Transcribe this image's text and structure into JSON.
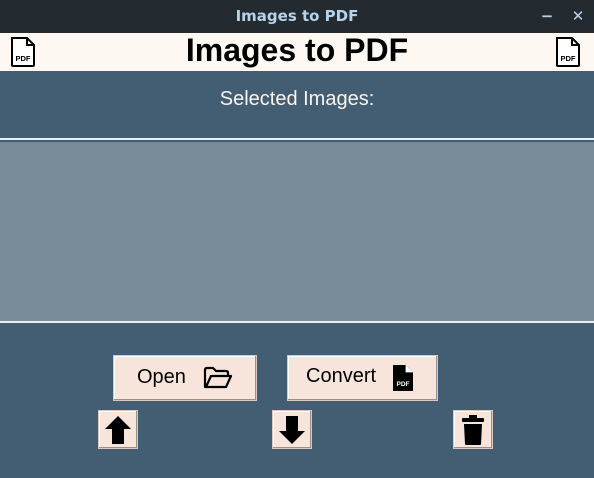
{
  "window": {
    "title": "Images to PDF",
    "minimize_glyph": "−",
    "close_glyph": "✕"
  },
  "header": {
    "title": "Images to PDF",
    "left_icon": "pdf-file-icon",
    "right_icon": "pdf-file-icon",
    "icon_text": "PDF"
  },
  "main": {
    "selected_label": "Selected Images:",
    "images": []
  },
  "buttons": {
    "open_label": "Open",
    "open_icon": "folder-open-icon",
    "convert_label": "Convert",
    "convert_icon": "pdf-file-icon",
    "convert_icon_text": "PDF",
    "move_up_icon": "arrow-up-icon",
    "move_down_icon": "arrow-down-icon",
    "delete_icon": "trash-icon"
  },
  "colors": {
    "background": "#435e72",
    "titlebar": "#232a30",
    "titlebar_text": "#b7d3ec",
    "header_bg": "#fef8f3",
    "listbox_bg": "#778b99",
    "button_bg": "#f7e5db"
  }
}
